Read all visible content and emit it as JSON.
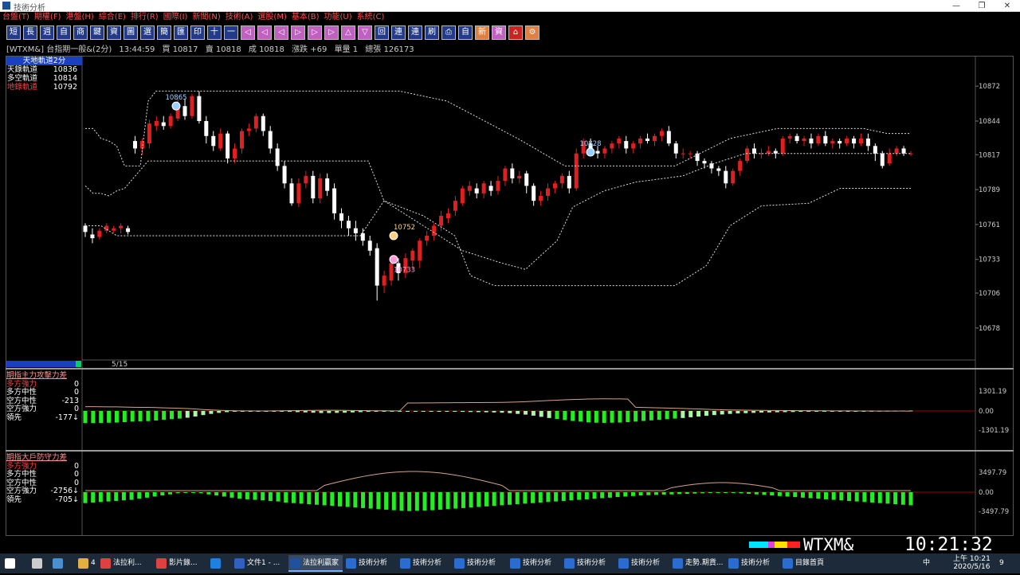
{
  "window": {
    "title": "技術分析",
    "min": "—",
    "restore": "❐",
    "close": "✕"
  },
  "menu": [
    "台盤(T)",
    "期權(F)",
    "港盤(H)",
    "綜合(E)",
    "排行(R)",
    "國際(I)",
    "新聞(N)",
    "技術(A)",
    "選股(M)",
    "基本(B)",
    "功能(U)",
    "系統(C)"
  ],
  "toolbar": [
    "短",
    "長",
    "週",
    "自",
    "商",
    "鍵",
    "資",
    "圖",
    "選",
    "簡",
    "匯",
    "印",
    "十",
    "一",
    "◁",
    "◁",
    "◁",
    "▷",
    "▷",
    "▷",
    "△",
    "▽",
    "回",
    "連",
    "連",
    "刷",
    "⎙",
    "自",
    "新",
    "資",
    "⌂",
    "⚙"
  ],
  "info": {
    "symbol": "[WTXM&] 台指期一般&(2分)",
    "time": "13:44:59",
    "buy": "買 10817",
    "sell": "賣 10818",
    "trade": "成 10818",
    "change": "漲跌 +69",
    "vol": "單量 1",
    "total": "總張 126173"
  },
  "legend": {
    "header": "天地軌道2分",
    "rows": [
      {
        "label": "天錄軌道",
        "value": "10836",
        "color": "white"
      },
      {
        "label": "多空軌道",
        "value": "10814",
        "color": "white"
      },
      {
        "label": "地錄軌道",
        "value": "10792",
        "color": "red"
      }
    ]
  },
  "date_label": "5/15",
  "ind1": {
    "header": "期指主力攻擊力差",
    "rows": [
      {
        "label": "多方強力",
        "value": "0",
        "color": "red"
      },
      {
        "label": "多方中性",
        "value": "0",
        "color": "white"
      },
      {
        "label": "空方中性",
        "value": "-213",
        "color": "white"
      },
      {
        "label": "空方強力",
        "value": "0",
        "color": "white"
      },
      {
        "label": "領先",
        "value": "-177↓",
        "color": "white"
      }
    ],
    "axis": [
      "1301.19",
      "0.00",
      "-1301.19"
    ]
  },
  "ind2": {
    "header": "期指大戶防守力差",
    "rows": [
      {
        "label": "多方強力",
        "value": "0",
        "color": "red"
      },
      {
        "label": "多方中性",
        "value": "0",
        "color": "white"
      },
      {
        "label": "空方中性",
        "value": "0",
        "color": "white"
      },
      {
        "label": "空方強力",
        "value": "-2756↓",
        "color": "white"
      },
      {
        "label": "領先",
        "value": "-705↓",
        "color": "white"
      }
    ],
    "axis": [
      "3497.79",
      "0.00",
      "-3497.79"
    ]
  },
  "price_axis": [
    "10872",
    "10844",
    "10817",
    "10789",
    "10761",
    "10733",
    "10706",
    "10678"
  ],
  "annotations": [
    {
      "text": "10865",
      "color": "#9ad0ff"
    },
    {
      "text": "10828",
      "color": "#9ad0ff"
    },
    {
      "text": "10752",
      "color": "#ffd27a"
    },
    {
      "text": "10733",
      "color": "#ff9ad8"
    }
  ],
  "status": {
    "symbol": "WTXM&",
    "clock": "10:21:32"
  },
  "taskbar": {
    "tasks": [
      "",
      "",
      "4",
      "法拉利...",
      "影片錄...",
      "",
      "文件1 - ...",
      "法拉利贏家",
      "技術分析",
      "技術分析",
      "技術分析",
      "技術分析",
      "技術分析",
      "技術分析",
      "走勢.期貨...",
      "技術分析",
      "目錄首頁"
    ],
    "time": "上午 10:21",
    "date": "2020/5/16",
    "ime": "中",
    "notif": "9"
  },
  "chart_data": {
    "type": "candlestick",
    "y_ticks": [
      10872,
      10844,
      10817,
      10789,
      10761,
      10733,
      10706,
      10678
    ],
    "ylim": [
      10660,
      10890
    ],
    "candles": [
      [
        10760,
        10755,
        10762,
        10751
      ],
      [
        10753,
        10750,
        10758,
        10746
      ],
      [
        10751,
        10756,
        10758,
        10749
      ],
      [
        10756,
        10760,
        10762,
        10754
      ],
      [
        10756,
        10758,
        10760,
        10754
      ],
      [
        10758,
        10760,
        10762,
        10754
      ],
      [
        10758,
        10755,
        10760,
        10753
      ],
      [
        10828,
        10822,
        10832,
        10818
      ],
      [
        10822,
        10828,
        10830,
        10817
      ],
      [
        10826,
        10842,
        10845,
        10822
      ],
      [
        10840,
        10844,
        10848,
        10836
      ],
      [
        10843,
        10840,
        10848,
        10837
      ],
      [
        10840,
        10848,
        10850,
        10838
      ],
      [
        10846,
        10858,
        10862,
        10844
      ],
      [
        10856,
        10848,
        10862,
        10845
      ],
      [
        10848,
        10864,
        10866,
        10846
      ],
      [
        10864,
        10844,
        10868,
        10842
      ],
      [
        10844,
        10832,
        10848,
        10826
      ],
      [
        10832,
        10824,
        10836,
        10820
      ],
      [
        10822,
        10834,
        10838,
        10820
      ],
      [
        10834,
        10814,
        10836,
        10810
      ],
      [
        10814,
        10822,
        10826,
        10810
      ],
      [
        10822,
        10836,
        10838,
        10818
      ],
      [
        10836,
        10838,
        10842,
        10832
      ],
      [
        10838,
        10848,
        10850,
        10835
      ],
      [
        10848,
        10836,
        10850,
        10832
      ],
      [
        10836,
        10822,
        10840,
        10818
      ],
      [
        10822,
        10808,
        10826,
        10804
      ],
      [
        10808,
        10794,
        10812,
        10790
      ],
      [
        10794,
        10778,
        10798,
        10776
      ],
      [
        10778,
        10794,
        10798,
        10775
      ],
      [
        10794,
        10800,
        10804,
        10790
      ],
      [
        10800,
        10782,
        10804,
        10778
      ],
      [
        10782,
        10798,
        10802,
        10778
      ],
      [
        10798,
        10788,
        10802,
        10784
      ],
      [
        10790,
        10770,
        10794,
        10765
      ],
      [
        10770,
        10764,
        10774,
        10758
      ],
      [
        10764,
        10758,
        10768,
        10752
      ],
      [
        10758,
        10754,
        10764,
        10748
      ],
      [
        10754,
        10748,
        10758,
        10744
      ],
      [
        10748,
        10740,
        10752,
        10736
      ],
      [
        10742,
        10712,
        10746,
        10700
      ],
      [
        10712,
        10720,
        10724,
        10706
      ],
      [
        10716,
        10730,
        10734,
        10712
      ],
      [
        10730,
        10722,
        10734,
        10716
      ],
      [
        10722,
        10734,
        10738,
        10718
      ],
      [
        10732,
        10740,
        10742,
        10724
      ],
      [
        10732,
        10748,
        10750,
        10726
      ],
      [
        10748,
        10752,
        10756,
        10744
      ],
      [
        10752,
        10760,
        10762,
        10748
      ],
      [
        10760,
        10768,
        10772,
        10756
      ],
      [
        10766,
        10770,
        10774,
        10762
      ],
      [
        10772,
        10780,
        10784,
        10768
      ],
      [
        10778,
        10790,
        10792,
        10776
      ],
      [
        10788,
        10792,
        10796,
        10784
      ],
      [
        10790,
        10786,
        10794,
        10782
      ],
      [
        10786,
        10794,
        10796,
        10782
      ],
      [
        10792,
        10788,
        10796,
        10784
      ],
      [
        10788,
        10796,
        10800,
        10785
      ],
      [
        10796,
        10806,
        10808,
        10792
      ],
      [
        10806,
        10798,
        10810,
        10794
      ],
      [
        10798,
        10800,
        10804,
        10794
      ],
      [
        10802,
        10792,
        10804,
        10786
      ],
      [
        10792,
        10780,
        10794,
        10776
      ],
      [
        10780,
        10784,
        10788,
        10776
      ],
      [
        10784,
        10790,
        10794,
        10780
      ],
      [
        10790,
        10794,
        10796,
        10786
      ],
      [
        10794,
        10800,
        10802,
        10790
      ],
      [
        10800,
        10790,
        10804,
        10786
      ],
      [
        10790,
        10818,
        10822,
        10788
      ],
      [
        10818,
        10828,
        10830,
        10814
      ],
      [
        10826,
        10820,
        10830,
        10818
      ],
      [
        10820,
        10818,
        10824,
        10814
      ],
      [
        10818,
        10822,
        10824,
        10814
      ],
      [
        10822,
        10826,
        10828,
        10818
      ],
      [
        10826,
        10830,
        10832,
        10822
      ],
      [
        10828,
        10822,
        10832,
        10818
      ],
      [
        10822,
        10826,
        10828,
        10818
      ],
      [
        10826,
        10830,
        10832,
        10822
      ],
      [
        10830,
        10828,
        10834,
        10826
      ],
      [
        10828,
        10832,
        10834,
        10824
      ],
      [
        10832,
        10836,
        10838,
        10828
      ],
      [
        10836,
        10826,
        10840,
        10824
      ],
      [
        10826,
        10818,
        10828,
        10814
      ],
      [
        10818,
        10818,
        10822,
        10814
      ],
      [
        10818,
        10818,
        10820,
        10814
      ],
      [
        10818,
        10812,
        10820,
        10808
      ],
      [
        10812,
        10810,
        10814,
        10806
      ],
      [
        10810,
        10806,
        10812,
        10802
      ],
      [
        10806,
        10804,
        10808,
        10800
      ],
      [
        10804,
        10794,
        10808,
        10790
      ],
      [
        10794,
        10804,
        10806,
        10792
      ],
      [
        10804,
        10812,
        10814,
        10800
      ],
      [
        10812,
        10822,
        10824,
        10810
      ],
      [
        10822,
        10818,
        10826,
        10814
      ],
      [
        10818,
        10818,
        10822,
        10814
      ],
      [
        10818,
        10820,
        10824,
        10816
      ],
      [
        10820,
        10818,
        10822,
        10814
      ],
      [
        10818,
        10830,
        10832,
        10816
      ],
      [
        10830,
        10832,
        10834,
        10826
      ],
      [
        10832,
        10828,
        10834,
        10826
      ],
      [
        10828,
        10830,
        10832,
        10824
      ],
      [
        10830,
        10826,
        10834,
        10822
      ],
      [
        10826,
        10832,
        10834,
        10824
      ],
      [
        10832,
        10826,
        10836,
        10824
      ],
      [
        10826,
        10828,
        10830,
        10822
      ],
      [
        10828,
        10826,
        10830,
        10822
      ],
      [
        10826,
        10830,
        10832,
        10824
      ],
      [
        10830,
        10826,
        10832,
        10822
      ],
      [
        10826,
        10830,
        10834,
        10824
      ],
      [
        10830,
        10824,
        10834,
        10820
      ],
      [
        10824,
        10818,
        10826,
        10812
      ],
      [
        10818,
        10808,
        10820,
        10806
      ],
      [
        10810,
        10818,
        10822,
        10808
      ],
      [
        10818,
        10822,
        10824,
        10816
      ],
      [
        10822,
        10818,
        10824,
        10816
      ],
      [
        10818,
        10818,
        10820,
        10816
      ]
    ],
    "upper_band": [
      [
        0,
        10838
      ],
      [
        1,
        10838
      ],
      [
        2,
        10830
      ],
      [
        3,
        10828
      ],
      [
        4,
        10824
      ],
      [
        5,
        10808
      ],
      [
        6,
        10808
      ],
      [
        7,
        10808
      ],
      [
        8,
        10860
      ],
      [
        9,
        10868
      ],
      [
        10,
        10868
      ],
      [
        11,
        10868
      ],
      [
        12,
        10868
      ],
      [
        40,
        10868
      ],
      [
        46,
        10860
      ],
      [
        55,
        10830
      ],
      [
        61,
        10808
      ],
      [
        70,
        10808
      ],
      [
        75,
        10808
      ],
      [
        82,
        10830
      ],
      [
        88,
        10838
      ],
      [
        99,
        10838
      ],
      [
        102,
        10834
      ],
      [
        105,
        10834
      ]
    ],
    "mid_band": [
      [
        0,
        10792
      ],
      [
        1,
        10786
      ],
      [
        2,
        10786
      ],
      [
        3,
        10784
      ],
      [
        4,
        10788
      ],
      [
        5,
        10790
      ],
      [
        8,
        10812
      ],
      [
        12,
        10812
      ],
      [
        30,
        10812
      ],
      [
        36,
        10812
      ],
      [
        38,
        10780
      ],
      [
        43,
        10760
      ],
      [
        48,
        10740
      ],
      [
        53,
        10730
      ],
      [
        56,
        10725
      ],
      [
        60,
        10748
      ],
      [
        62,
        10775
      ],
      [
        66,
        10788
      ],
      [
        70,
        10795
      ],
      [
        76,
        10800
      ],
      [
        80,
        10810
      ],
      [
        84,
        10818
      ],
      [
        87,
        10818
      ],
      [
        90,
        10818
      ],
      [
        105,
        10818
      ]
    ],
    "lower_band": [
      [
        0,
        10760
      ],
      [
        2,
        10760
      ],
      [
        4,
        10752
      ],
      [
        8,
        10752
      ],
      [
        20,
        10752
      ],
      [
        30,
        10752
      ],
      [
        35,
        10752
      ],
      [
        38,
        10780
      ],
      [
        43,
        10768
      ],
      [
        47,
        10752
      ],
      [
        49,
        10720
      ],
      [
        52,
        10712
      ],
      [
        60,
        10712
      ],
      [
        70,
        10712
      ],
      [
        75,
        10712
      ],
      [
        79,
        10728
      ],
      [
        82,
        10760
      ],
      [
        86,
        10776
      ],
      [
        92,
        10778
      ],
      [
        96,
        10790
      ],
      [
        105,
        10790
      ]
    ],
    "ind1_bars": [
      -830,
      -830,
      -820,
      -800,
      -790,
      -760,
      -720,
      -700,
      -690,
      -650,
      -600,
      -560,
      -520,
      -460,
      -380,
      -280,
      -200,
      -130,
      -80,
      -40,
      -20,
      -10,
      -5,
      0,
      -20,
      -40,
      -60,
      -80,
      -100,
      -120,
      -140,
      -140,
      -130,
      -120,
      -100,
      -80,
      -60,
      -40,
      -30,
      -20,
      -10,
      -5,
      0,
      -10,
      -20,
      -30,
      -40,
      -50,
      -60,
      -70,
      -80,
      -90,
      -100,
      -120,
      -150,
      -200,
      -250,
      -320,
      -400,
      -480,
      -550,
      -620,
      -680,
      -720,
      -780,
      -800,
      -810,
      -800,
      -790,
      -760,
      -720,
      -680,
      -640,
      -600,
      -560,
      -520,
      -480,
      -430,
      -380,
      -330,
      -280,
      -240,
      -200,
      -170,
      -150,
      -130,
      -110,
      -100,
      -90,
      -80,
      -70,
      -60,
      -50,
      -40,
      -30,
      -20,
      -15,
      -10,
      -5,
      0,
      5,
      10,
      15,
      20,
      25,
      30
    ],
    "ind2_bars": [
      -2000,
      -1900,
      -1800,
      -1700,
      -1600,
      -1500,
      -1400,
      -1200,
      -1000,
      -800,
      -600,
      -400,
      -200,
      -100,
      -80,
      -200,
      -400,
      -600,
      -800,
      -1000,
      -1200,
      -1300,
      -1400,
      -1500,
      -1600,
      -1700,
      -1900,
      -2000,
      -2100,
      -2200,
      -2300,
      -2400,
      -2500,
      -2600,
      -2700,
      -2800,
      -2900,
      -3000,
      -3100,
      -3200,
      -3300,
      -3400,
      -3450,
      -3400,
      -3350,
      -3300,
      -3200,
      -3100,
      -3000,
      -2900,
      -2800,
      -2700,
      -2600,
      -2500,
      -2400,
      -2300,
      -2200,
      -2100,
      -2000,
      -1900,
      -1800,
      -1700,
      -1600,
      -1500,
      -1400,
      -1300,
      -1200,
      -1100,
      -1000,
      -900,
      -800,
      -700,
      -600,
      -550,
      -500,
      -450,
      -400,
      -350,
      -300,
      -250,
      -200,
      -150,
      -100,
      -50,
      -100,
      -200,
      -300,
      -400,
      -500,
      -600,
      -700,
      -800,
      -900,
      -1000,
      -1100,
      -1200,
      -1300,
      -1400,
      -1500,
      -1600,
      -1700,
      -1800,
      -1900,
      -2000,
      -2100,
      -2200,
      -2300,
      -2400
    ]
  }
}
